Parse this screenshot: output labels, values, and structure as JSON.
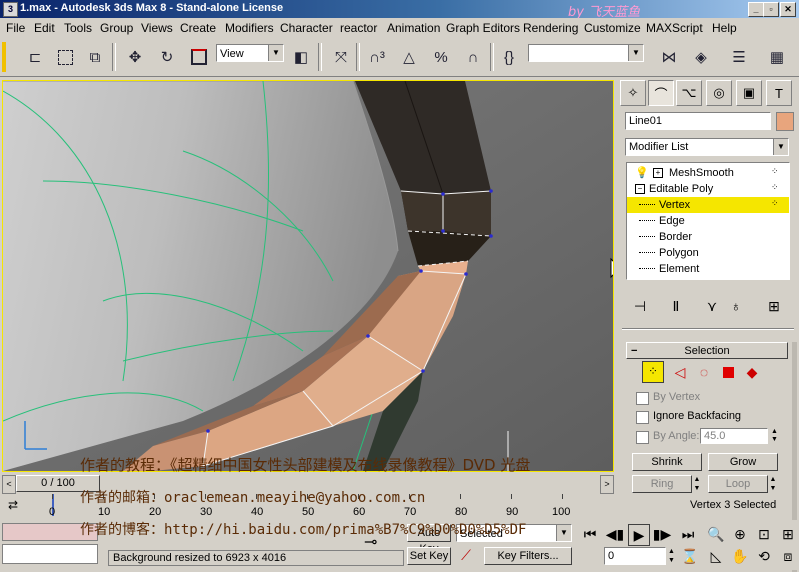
{
  "window": {
    "title": "1.max - Autodesk 3ds Max 8  - Stand-alone License",
    "app_icon": "3ds-max-icon"
  },
  "watermark": "by 飞天蓝鱼",
  "menu": [
    "File",
    "Edit",
    "Tools",
    "Group",
    "Views",
    "Create",
    "Modifiers",
    "Character",
    "reactor",
    "Animation",
    "Graph Editors",
    "Rendering",
    "Customize",
    "MAXScript",
    "Help"
  ],
  "toolbar": {
    "view_combo": "View",
    "selection_set": "",
    "icons": [
      "undo-icon",
      "redo-icon",
      "select-icon",
      "region-select-icon",
      "select-by-name-icon",
      "move-icon",
      "rotate-icon",
      "scale-icon",
      "angle-snap-icon",
      "percent-snap-icon",
      "spinner-snap-icon",
      "mirror-icon",
      "align-icon",
      "layer-icon",
      "schematic-icon"
    ]
  },
  "panel": {
    "tabs": [
      "create-tab",
      "modify-tab",
      "hierarchy-tab",
      "motion-tab",
      "display-tab",
      "utilities-tab"
    ],
    "object_name": "Line01",
    "object_color": "#e8a57d",
    "modifier_list": "Modifier List",
    "stack": [
      {
        "label": "MeshSmooth",
        "level": 0
      },
      {
        "label": "Editable Poly",
        "level": 0
      },
      {
        "label": "Vertex",
        "level": 1,
        "selected": true
      },
      {
        "label": "Edge",
        "level": 1
      },
      {
        "label": "Border",
        "level": 1
      },
      {
        "label": "Polygon",
        "level": 1
      },
      {
        "label": "Element",
        "level": 1
      }
    ],
    "selection_rollout": {
      "title": "Selection",
      "by_vertex": "By Vertex",
      "ignore_backfacing": "Ignore Backfacing",
      "by_angle": "By Angle:",
      "angle_value": "45.0",
      "shrink": "Shrink",
      "grow": "Grow",
      "ring": "Ring",
      "loop": "Loop",
      "status": "Vertex 3 Selected"
    }
  },
  "timeline": {
    "frame_label": "0 / 100",
    "ticks": [
      "0",
      "10",
      "20",
      "30",
      "40",
      "50",
      "60",
      "70",
      "80",
      "90",
      "100"
    ]
  },
  "status": {
    "prompt": "Background resized to 6923 x 4016",
    "auto_key": "Auto Key",
    "set_key": "Set Key",
    "selected": "Selected",
    "key_filters": "Key Filters...",
    "frame": "0"
  },
  "overlay": {
    "line1": "作者的教程：《超精细中国女性头部建模及布线录像教程》DVD 光盘",
    "line2": "作者的邮箱：oraclemean.meayihe@yahoo.com.cn",
    "line3": "作者的博客：http://hi.baidu.com/prima%B7%C9%D0%D0%D5%DF"
  },
  "colors": {
    "selected_highlight": "#f5e600",
    "title_gradient_start": "#0a246a",
    "skin": "#d9a584",
    "dark_surface": "#2f2a26",
    "wire_green": "#27c07a"
  }
}
